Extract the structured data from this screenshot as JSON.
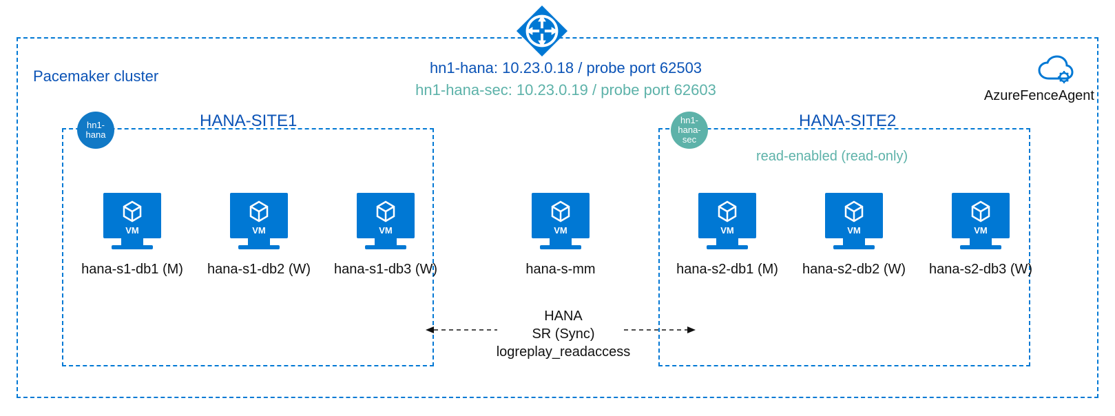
{
  "cluster_title": "Pacemaker cluster",
  "load_balancer": {
    "line1": "hn1-hana:  10.23.0.18 / probe port 62503",
    "line2": "hn1-hana-sec: 10.23.0.19 / probe port 62603"
  },
  "fence_label": "AzureFenceAgent",
  "site1": {
    "title": "HANA-SITE1",
    "badge": "hn1-hana",
    "vms": [
      {
        "name": "hana-s1-db1 (M)"
      },
      {
        "name": "hana-s1-db2 (W)"
      },
      {
        "name": "hana-s1-db3 (W)"
      }
    ]
  },
  "site2": {
    "title": "HANA-SITE2",
    "badge": "hn1-hana-sec",
    "read_label": "read-enabled (read-only)",
    "vms": [
      {
        "name": "hana-s2-db1 (M)"
      },
      {
        "name": "hana-s2-db2 (W)"
      },
      {
        "name": "hana-s2-db3 (W)"
      }
    ]
  },
  "middle_vm": {
    "name": "hana-s-mm"
  },
  "replication": {
    "line1": "HANA",
    "line2": "SR (Sync)",
    "line3": "logreplay_readaccess"
  },
  "colors": {
    "azure_blue": "#0078d4",
    "deep_blue": "#0b53b6",
    "teal": "#5db2a9"
  }
}
